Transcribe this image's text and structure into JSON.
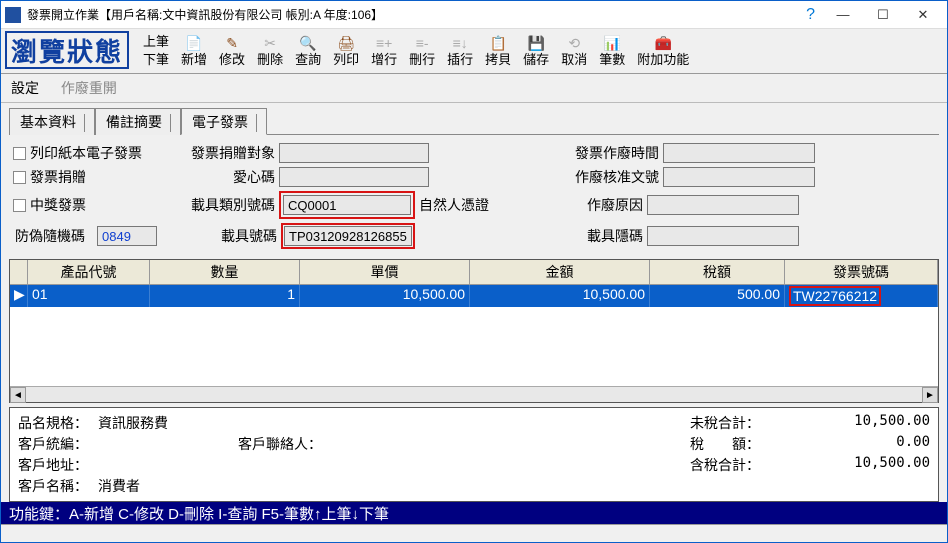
{
  "window": {
    "title": "發票開立作業【用戶名稱:文中資訊股份有限公司  帳別:A  年度:106】"
  },
  "status_label": "瀏覽狀態",
  "toolbar": {
    "prev": "上筆",
    "next": "下筆",
    "add": "新增",
    "edit": "修改",
    "delete": "刪除",
    "query": "查詢",
    "print": "列印",
    "addrow": "增行",
    "delrow": "刪行",
    "insrow": "插行",
    "copy": "拷貝",
    "save": "儲存",
    "cancel": "取消",
    "count": "筆數",
    "extra": "附加功能"
  },
  "menu": {
    "settings": "設定",
    "void": "作廢重開"
  },
  "tabs": {
    "t1": "基本資料",
    "t2": "備註摘要",
    "t3": "電子發票"
  },
  "form": {
    "cb1": "列印紙本電子發票",
    "cb2": "發票捐贈",
    "cb3": "中獎發票",
    "rand_lbl": "防偽隨機碼",
    "rand_val": "0849",
    "donate_lbl": "發票捐贈對象",
    "love_lbl": "愛心碼",
    "carrier_type_lbl": "載具類別號碼",
    "carrier_type_val": "CQ0001",
    "carrier_desc": "自然人憑證",
    "carrier_no_lbl": "載具號碼",
    "carrier_no_val": "TP03120928126855",
    "void_time_lbl": "發票作廢時間",
    "void_appr_lbl": "作廢核准文號",
    "void_reason_lbl": "作廢原因",
    "carrier_hide_lbl": "載具隱碼"
  },
  "grid": {
    "headers": {
      "h0": "",
      "h1": "產品代號",
      "h2": "數量",
      "h3": "單價",
      "h4": "金額",
      "h5": "稅額",
      "h6": "發票號碼"
    },
    "row": {
      "prod": "01",
      "qty": "1",
      "price": "10,500.00",
      "amount": "10,500.00",
      "tax": "500.00",
      "invno": "TW22766212"
    }
  },
  "summary": {
    "spec_lbl": "品名規格：",
    "spec_val": "資訊服務費",
    "custno_lbl": "客戶統編：",
    "custno_val": "",
    "contact_lbl": "客戶聯絡人：",
    "contact_val": "",
    "addr_lbl": "客戶地址：",
    "name_lbl": "客戶名稱：",
    "name_val": "消費者",
    "sub_lbl": "未稅合計：",
    "sub_val": "10,500.00",
    "tax_lbl": "稅　　額：",
    "tax_val": "0.00",
    "total_lbl": "含稅合計：",
    "total_val": "10,500.00"
  },
  "fnkeys": "功能鍵：A-新增 C-修改 D-刪除 I-查詢 F5-筆數↑上筆↓下筆"
}
